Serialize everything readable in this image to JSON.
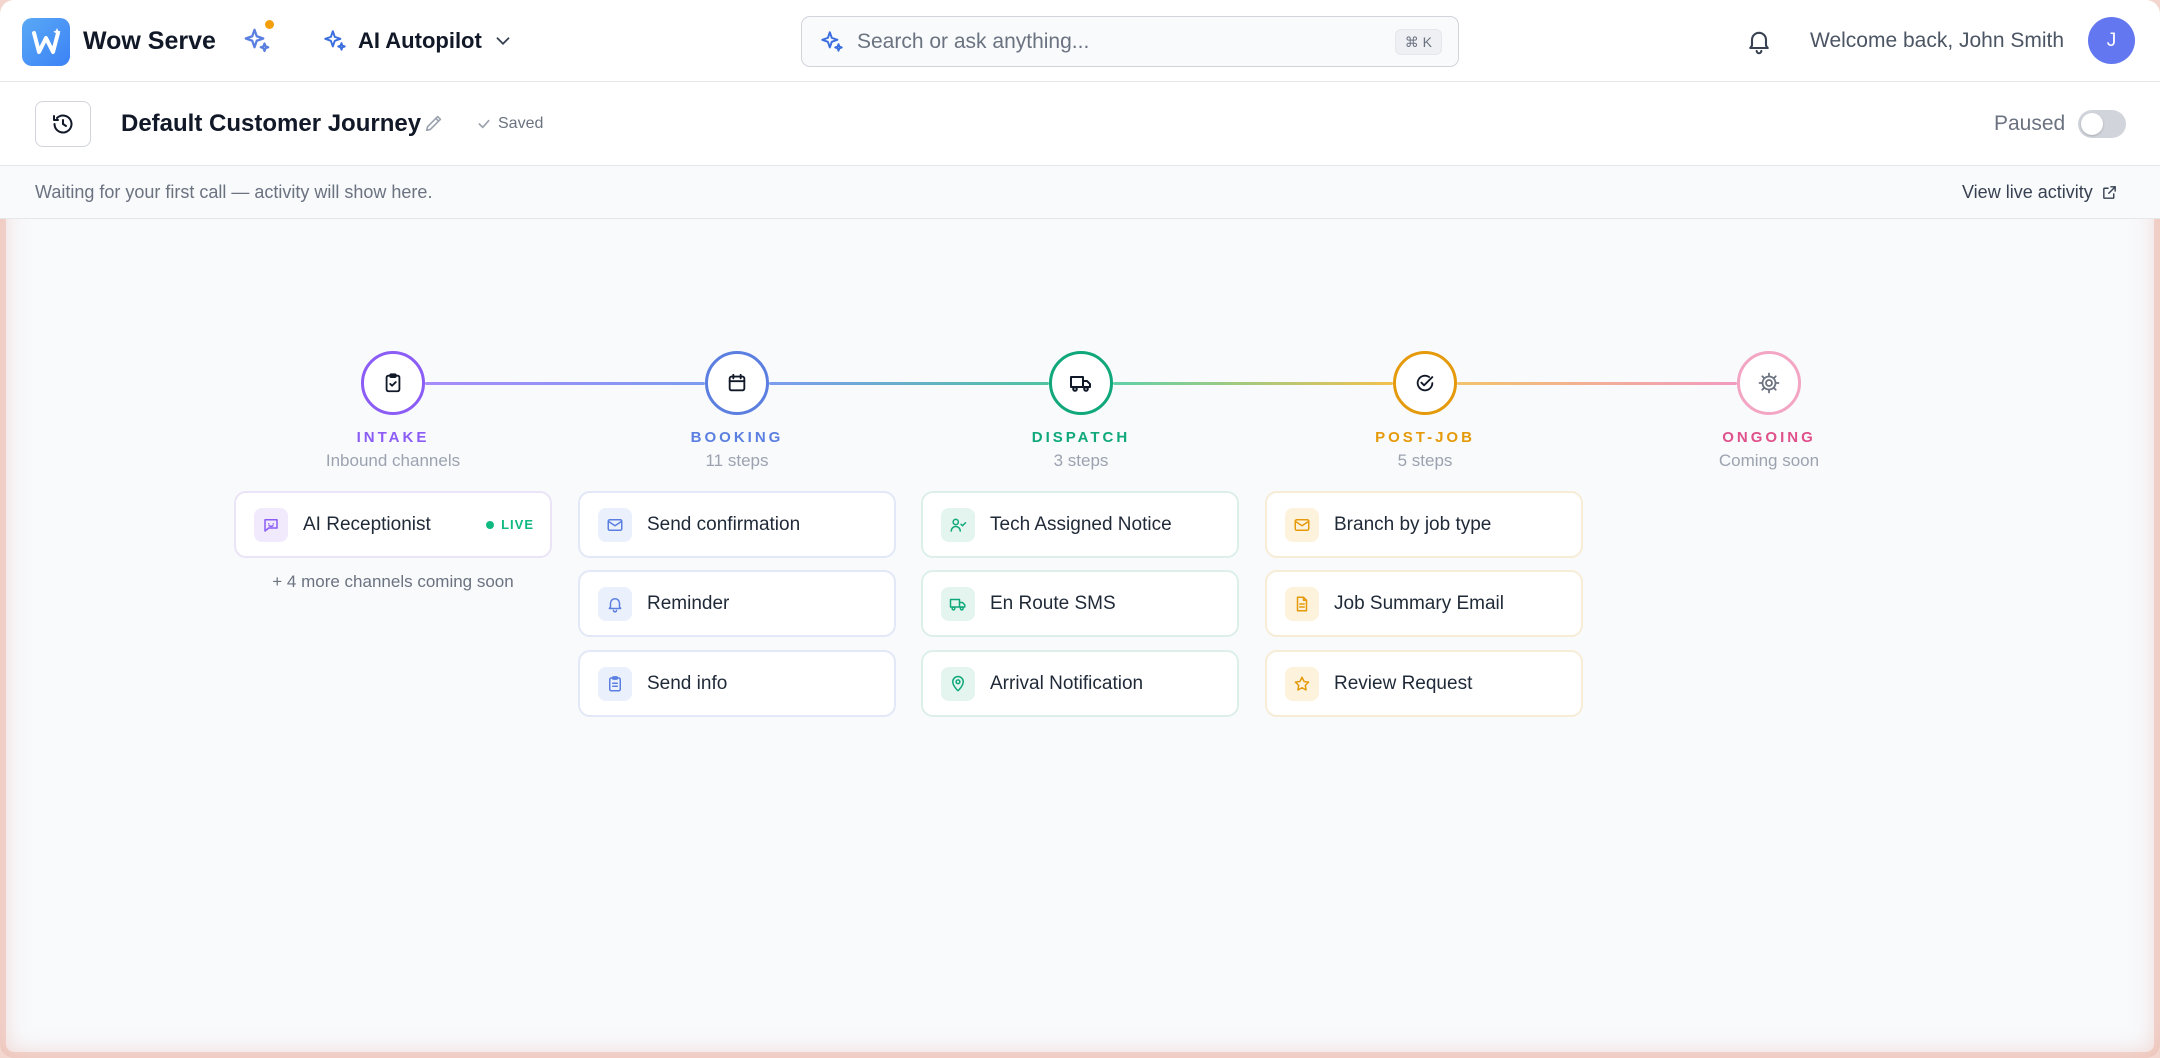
{
  "app": {
    "brand": "Wow Serve",
    "autopilot_label": "AI Autopilot",
    "search_placeholder": "Search or ask anything...",
    "search_shortcut": "⌘ K",
    "welcome": "Welcome back, John Smith",
    "avatar_initial": "J"
  },
  "journey": {
    "title": "Default Customer Journey",
    "saved_label": "Saved",
    "status_label": "Paused",
    "toggle_on": false,
    "activity_text": "Waiting for your first call — activity will show here.",
    "view_live_label": "View live activity"
  },
  "stages": [
    {
      "name": "INTAKE",
      "sub": "Inbound channels",
      "color": "#8b5cf6",
      "icon": "clipboard-check-icon"
    },
    {
      "name": "BOOKING",
      "sub": "11 steps",
      "color": "#5b7fe0",
      "icon": "calendar-icon"
    },
    {
      "name": "DISPATCH",
      "sub": "3 steps",
      "color": "#10a87a",
      "icon": "truck-icon"
    },
    {
      "name": "POST-JOB",
      "sub": "5 steps",
      "color": "#e59a0b",
      "icon": "check-circle-icon"
    },
    {
      "name": "ONGOING",
      "sub": "Coming soon",
      "color": "#e0508a",
      "icon": "gear-icon"
    }
  ],
  "intake": {
    "card": {
      "label": "AI Receptionist",
      "badge": "LIVE",
      "icon": "chat-bot-icon"
    },
    "more_note": "+ 4 more channels coming soon"
  },
  "booking": [
    {
      "label": "Send confirmation",
      "icon": "mail-icon"
    },
    {
      "label": "Reminder",
      "icon": "bell-icon"
    },
    {
      "label": "Send info",
      "icon": "clipboard-icon"
    }
  ],
  "dispatch": [
    {
      "label": "Tech Assigned Notice",
      "icon": "user-check-icon"
    },
    {
      "label": "En Route SMS",
      "icon": "truck-icon"
    },
    {
      "label": "Arrival Notification",
      "icon": "map-pin-icon"
    }
  ],
  "postjob": [
    {
      "label": "Branch by job type",
      "icon": "mail-icon"
    },
    {
      "label": "Job Summary Email",
      "icon": "document-icon"
    },
    {
      "label": "Review Request",
      "icon": "star-icon"
    }
  ]
}
